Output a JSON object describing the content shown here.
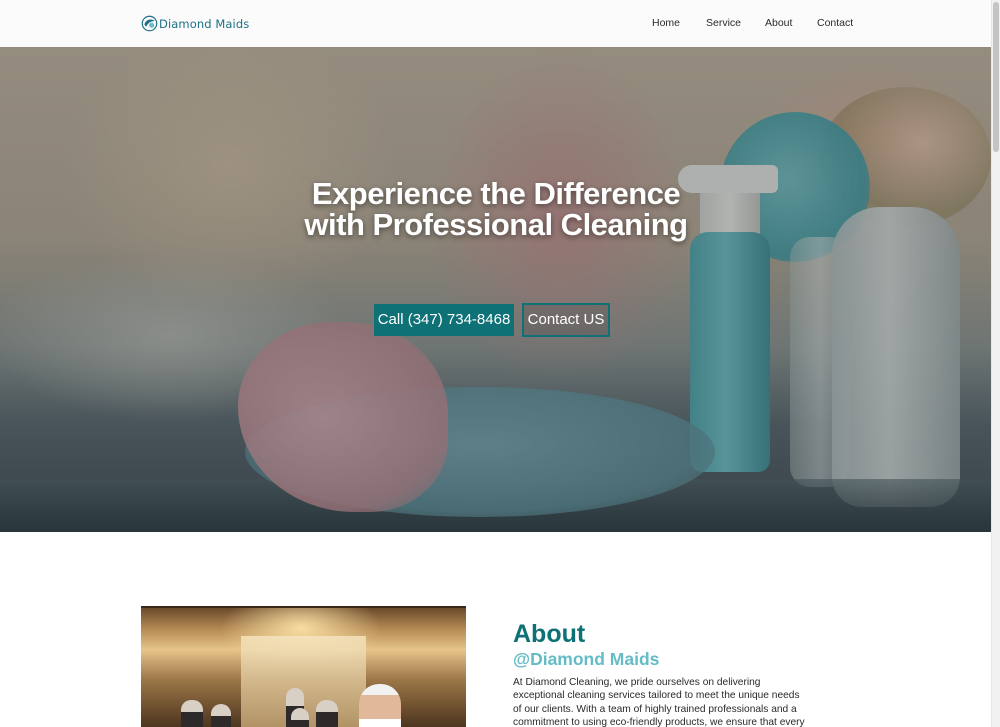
{
  "header": {
    "logo_text": "Diamond Maids",
    "nav": [
      {
        "label": "Home"
      },
      {
        "label": "Service"
      },
      {
        "label": "About"
      },
      {
        "label": "Contact"
      }
    ]
  },
  "hero": {
    "title": "Experience the Difference with Professional Cleaning",
    "call_button": "Call (347) 734-8468",
    "contact_button": "Contact US"
  },
  "about": {
    "title": "About",
    "subtitle": "@Diamond Maids",
    "text": "At Diamond Cleaning, we pride ourselves on delivering exceptional cleaning services tailored to meet the unique needs of our clients. With a team of highly trained professionals and a commitment to using eco-friendly products, we ensure that every space we touch is not only"
  },
  "colors": {
    "brand": "#0e7176",
    "accent": "#64bcc6",
    "logo": "#1d6f86"
  },
  "icons": {
    "logo_mark": "diamond-logo-icon"
  }
}
